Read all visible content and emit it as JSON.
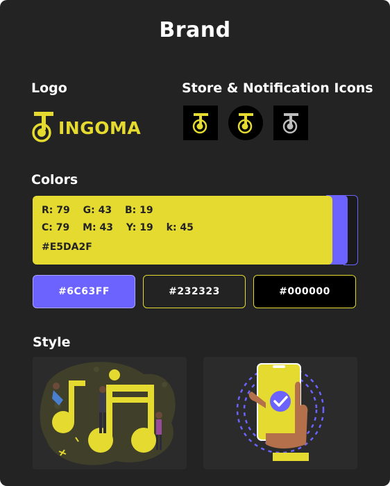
{
  "header": {
    "title": "Brand"
  },
  "logo": {
    "heading": "Logo",
    "wordmark": "INGOMA"
  },
  "store_icons": {
    "heading": "Store & Notification Icons"
  },
  "colors": {
    "heading": "Colors",
    "primary": {
      "rgb": {
        "r": "R: 79",
        "g": "G: 43",
        "b": "B: 19"
      },
      "cmyk": {
        "c": "C: 79",
        "m": "M: 43",
        "y": "Y: 19",
        "k": "k: 45"
      },
      "hex": "#E5DA2F"
    },
    "swatches": [
      {
        "label": "#6C63FF",
        "color": "#6C63FF"
      },
      {
        "label": "#232323",
        "color": "#232323"
      },
      {
        "label": "#000000",
        "color": "#000000"
      }
    ],
    "brand_yellow": "#E5DA2F",
    "brand_purple": "#6C63FF"
  },
  "style": {
    "heading": "Style"
  }
}
